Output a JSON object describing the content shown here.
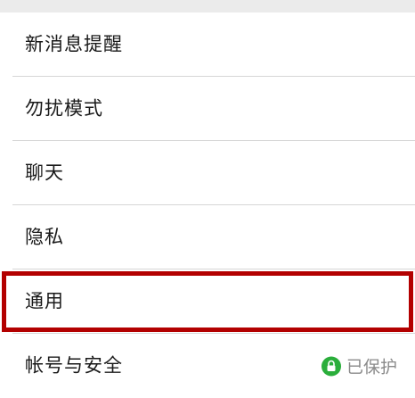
{
  "settings": {
    "items": [
      {
        "label": "新消息提醒"
      },
      {
        "label": "勿扰模式"
      },
      {
        "label": "聊天"
      },
      {
        "label": "隐私"
      },
      {
        "label": "通用"
      },
      {
        "label": "帐号与安全",
        "status": "已保护"
      }
    ]
  },
  "colors": {
    "highlight_border": "#b30000",
    "protected_badge": "#2aae3b"
  },
  "icons": {
    "protected": "lock-icon"
  }
}
